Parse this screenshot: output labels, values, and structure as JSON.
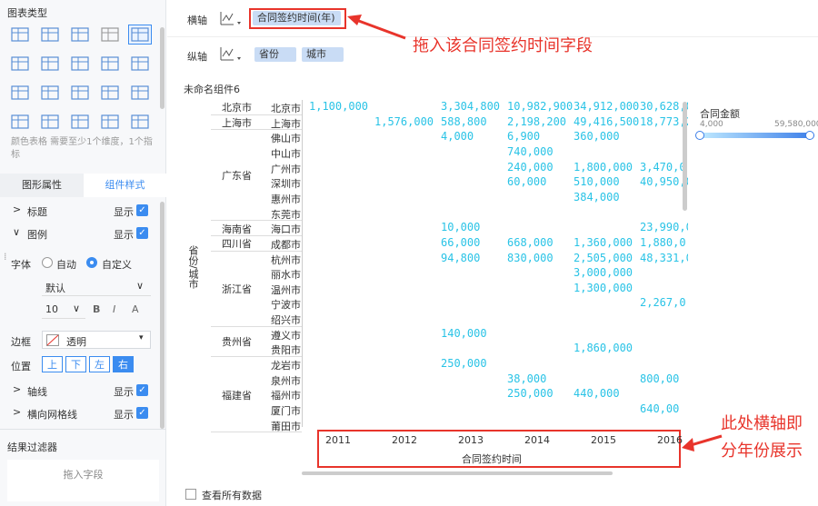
{
  "sidebar": {
    "chart_type_title": "图表类型",
    "chart_type_hint": "颜色表格 需要至少1个维度，1个指标",
    "tabs": [
      "图形属性",
      "组件样式"
    ],
    "legend_section": {
      "title_label": "标题",
      "title_show": "显示",
      "legend_label": "图例",
      "legend_show": "显示",
      "font_label": "字体",
      "font_auto": "自动",
      "font_custom": "自定义",
      "font_family": "默认",
      "font_size": "10",
      "border_label": "边框",
      "border_value": "透明",
      "position_label": "位置",
      "positions": [
        "上",
        "下",
        "左",
        "右"
      ],
      "axis_label": "轴线",
      "axis_show": "显示",
      "hgrid_label": "横向网格线",
      "hgrid_show": "显示"
    },
    "filter_title": "结果过滤器",
    "filter_placeholder": "拖入字段"
  },
  "axis": {
    "x_label": "横轴",
    "x_field": "合同签约时间(年)",
    "y_label": "纵轴",
    "y_fields": [
      "省份",
      "城市"
    ]
  },
  "annotations": {
    "drag_hint": "拖入该合同签约时间字段",
    "axis_hint": "此处横轴即\n分年份展示"
  },
  "component": {
    "title": "未命名组件6",
    "row_axis_label": "省份/城市",
    "x_axis_title": "合同签约时间",
    "years": [
      "2011",
      "2012",
      "2013",
      "2014",
      "2015",
      "2016"
    ],
    "view_all": "查看所有数据"
  },
  "legend": {
    "title": "合同金额",
    "min": "4,000",
    "max": "59,580,000",
    "gradient": [
      "#bfe9ff",
      "#3b7de8"
    ]
  },
  "table": {
    "provinces": [
      {
        "name": "北京市",
        "cities": [
          {
            "name": "北京市",
            "v": [
              "1,100,000",
              "",
              "3,304,800",
              "10,982,900",
              "34,912,000",
              "30,628,0"
            ]
          }
        ]
      },
      {
        "name": "上海市",
        "cities": [
          {
            "name": "上海市",
            "v": [
              "",
              "1,576,000",
              "588,800",
              "2,198,200",
              "49,416,500",
              "18,773,2"
            ]
          }
        ]
      },
      {
        "name": "广东省",
        "cities": [
          {
            "name": "佛山市",
            "v": [
              "",
              "",
              "4,000",
              "6,900",
              "360,000",
              ""
            ]
          },
          {
            "name": "中山市",
            "v": [
              "",
              "",
              "",
              "740,000",
              "",
              ""
            ]
          },
          {
            "name": "广州市",
            "v": [
              "",
              "",
              "",
              "240,000",
              "1,800,000",
              "3,470,0"
            ]
          },
          {
            "name": "深圳市",
            "v": [
              "",
              "",
              "",
              "60,000",
              "510,000",
              "40,950,0"
            ]
          },
          {
            "name": "惠州市",
            "v": [
              "",
              "",
              "",
              "",
              "384,000",
              ""
            ]
          },
          {
            "name": "东莞市",
            "v": [
              "",
              "",
              "",
              "",
              "",
              ""
            ]
          }
        ]
      },
      {
        "name": "海南省",
        "cities": [
          {
            "name": "海口市",
            "v": [
              "",
              "",
              "10,000",
              "",
              "",
              "23,990,0"
            ]
          }
        ]
      },
      {
        "name": "四川省",
        "cities": [
          {
            "name": "成都市",
            "v": [
              "",
              "",
              "66,000",
              "668,000",
              "1,360,000",
              "1,880,0"
            ]
          }
        ]
      },
      {
        "name": "浙江省",
        "cities": [
          {
            "name": "杭州市",
            "v": [
              "",
              "",
              "94,800",
              "830,000",
              "2,505,000",
              "48,331,0"
            ]
          },
          {
            "name": "丽水市",
            "v": [
              "",
              "",
              "",
              "",
              "3,000,000",
              ""
            ]
          },
          {
            "name": "温州市",
            "v": [
              "",
              "",
              "",
              "",
              "1,300,000",
              ""
            ]
          },
          {
            "name": "宁波市",
            "v": [
              "",
              "",
              "",
              "",
              "",
              "2,267,0"
            ]
          },
          {
            "name": "绍兴市",
            "v": [
              "",
              "",
              "",
              "",
              "",
              ""
            ]
          }
        ]
      },
      {
        "name": "贵州省",
        "cities": [
          {
            "name": "遵义市",
            "v": [
              "",
              "",
              "140,000",
              "",
              "",
              ""
            ]
          },
          {
            "name": "贵阳市",
            "v": [
              "",
              "",
              "",
              "",
              "1,860,000",
              ""
            ]
          }
        ]
      },
      {
        "name": "福建省",
        "cities": [
          {
            "name": "龙岩市",
            "v": [
              "",
              "",
              "250,000",
              "",
              "",
              ""
            ]
          },
          {
            "name": "泉州市",
            "v": [
              "",
              "",
              "",
              "38,000",
              "",
              "800,00"
            ]
          },
          {
            "name": "福州市",
            "v": [
              "",
              "",
              "",
              "250,000",
              "440,000",
              ""
            ]
          },
          {
            "name": "厦门市",
            "v": [
              "",
              "",
              "",
              "",
              "",
              "640,00"
            ]
          },
          {
            "name": "莆田市",
            "v": [
              "",
              "",
              "",
              "",
              "",
              ""
            ]
          }
        ]
      }
    ]
  },
  "colors": {
    "accent": "#3b8cf0",
    "value": "#29c3e6",
    "annotation": "#e8342b"
  }
}
